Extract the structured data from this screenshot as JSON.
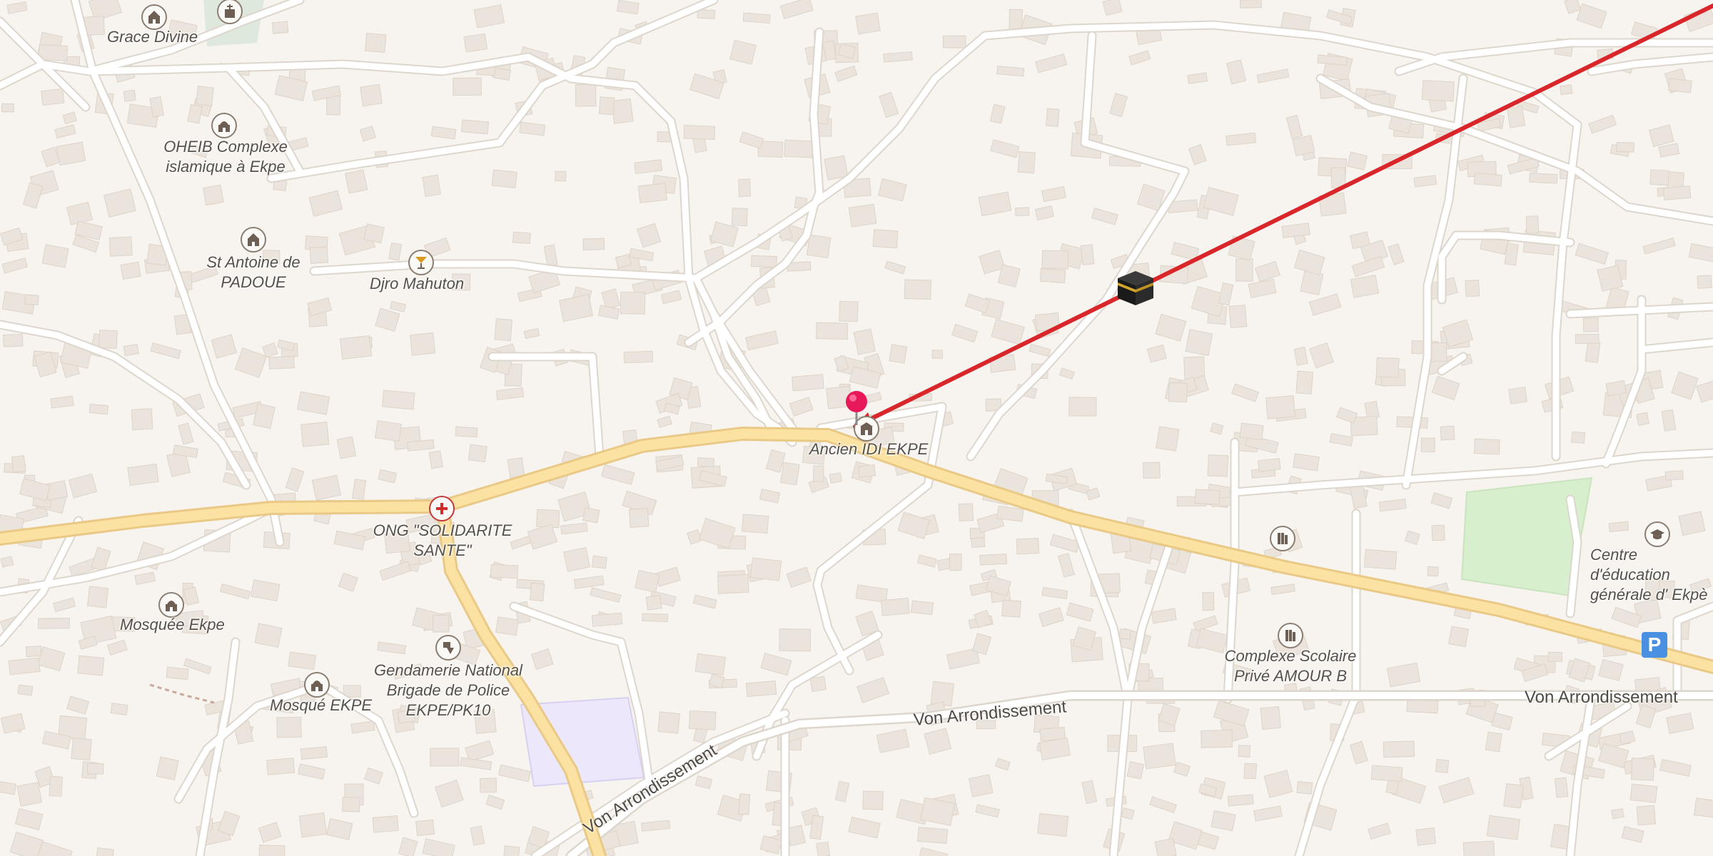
{
  "map": {
    "colors": {
      "land": "#f7f4f0",
      "building": "#ebe4dc",
      "road": "#ffffff",
      "road_casing": "#ddd6cd",
      "main_road": "#fbe2a2",
      "main_road_casing": "#e9c985",
      "park": "#d7efcd",
      "school_area": "#ece7fb",
      "route_line": "#d9262a",
      "pin": "#e8195a",
      "parking": "#4a90e2"
    },
    "places": [
      {
        "label": "Grace Divine",
        "icon": "church-icon"
      },
      {
        "label": "OHEIB Complexe islamique à Ekpe",
        "icon": "mosque-icon"
      },
      {
        "label": "St Antoine de PADOUE",
        "icon": "church-icon"
      },
      {
        "label": "Djro Mahuton",
        "icon": "bar-icon"
      },
      {
        "label": "ONG \"SOLIDARITE SANTE\"",
        "icon": "red-cross-icon"
      },
      {
        "label": "Mosquée Ekpe",
        "icon": "mosque-icon"
      },
      {
        "label": "Mosqué EKPE",
        "icon": "mosque-icon"
      },
      {
        "label": "Gendamerie National Brigade de Police EKPE/PK10",
        "icon": "police-icon"
      },
      {
        "label": "Ancien IDI EKPE",
        "icon": "school-icon"
      },
      {
        "label": "Complexe Scolaire Privé AMOUR B",
        "icon": "school-icon"
      },
      {
        "label": "Centre d'éducation générale d' Ekpè",
        "icon": "graduation-cap-icon"
      }
    ],
    "roads": {
      "von_arrondissement_1": "Von Arrondissement",
      "von_arrondissement_2": "Von Arrondissement",
      "von_arrondissement_3": "Von Arrondissement"
    },
    "markers": {
      "pin": "pin-marker-icon",
      "kaaba": "kaaba-icon",
      "parking": "P"
    }
  }
}
